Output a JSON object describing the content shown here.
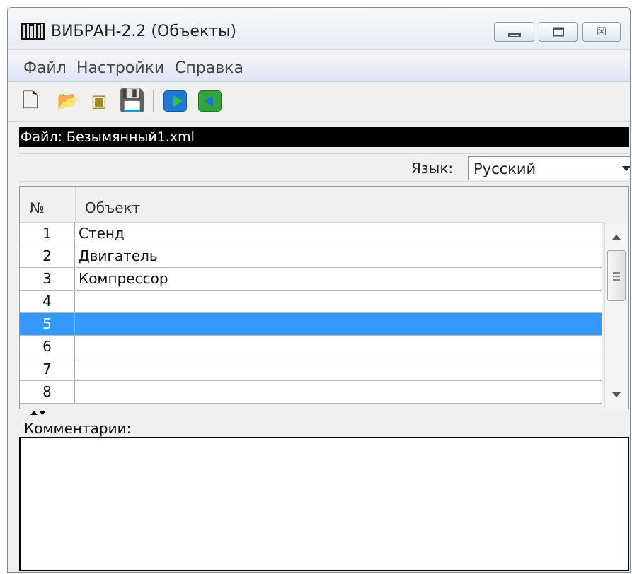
{
  "window": {
    "title": "ВИБРАН-2.2 (Объекты)",
    "icon": "app-equalizer-icon",
    "controls": {
      "minimize": "minimize-icon",
      "maximize": "maximize-icon",
      "close": "close-icon",
      "close_glyph": "☒"
    }
  },
  "menu": {
    "items": [
      "Файл",
      "Настройки",
      "Справка"
    ]
  },
  "toolbar": {
    "icons": {
      "new": "new-file-icon",
      "open": "open-folder-icon",
      "properties": "document-properties-icon",
      "save": "save-icon",
      "import": "import-arrow-icon",
      "export": "export-arrow-icon"
    },
    "glyphs": {
      "new": "🗋",
      "open": "📂",
      "properties": "▣",
      "save": "💾"
    }
  },
  "file_bar": {
    "text": "Файл: Безымянный1.xml"
  },
  "language": {
    "label": "Язык:",
    "selected": "Русский"
  },
  "table": {
    "headers": {
      "number": "№",
      "object": "Объект"
    },
    "rows": [
      {
        "number": "1",
        "name": "Стенд"
      },
      {
        "number": "2",
        "name": "Двигатель"
      },
      {
        "number": "3",
        "name": "Компрессор"
      },
      {
        "number": "4",
        "name": ""
      },
      {
        "number": "5",
        "name": ""
      },
      {
        "number": "6",
        "name": ""
      },
      {
        "number": "7",
        "name": ""
      },
      {
        "number": "8",
        "name": ""
      }
    ],
    "selected_row": "5"
  },
  "comments": {
    "label": "Комментарии:",
    "value": ""
  },
  "colors": {
    "selection": "#3399ff",
    "file_bar_background": "#000000",
    "window_background": "#f0f0f0"
  }
}
